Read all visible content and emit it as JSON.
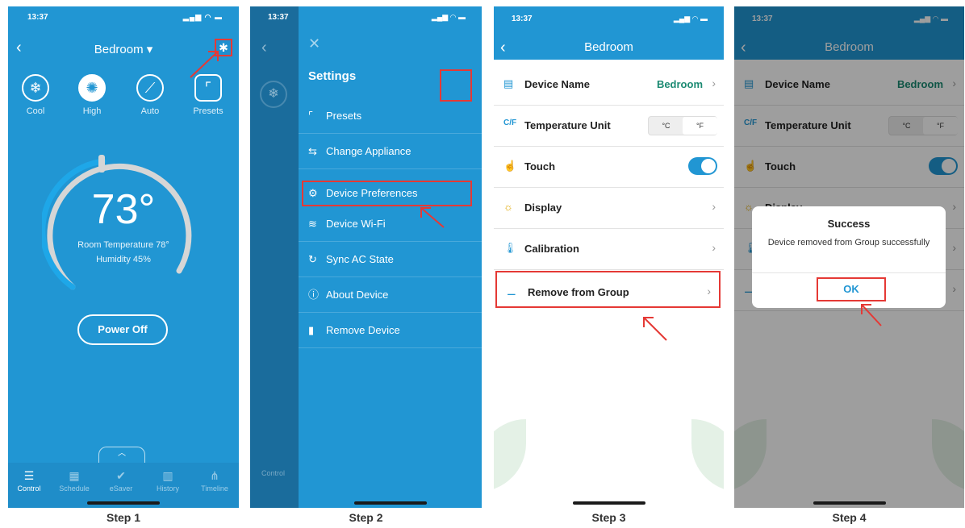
{
  "step1": {
    "time": "13:37",
    "title": "Bedroom ▾",
    "modes": [
      {
        "label": "Cool",
        "icon": "snowflake-icon"
      },
      {
        "label": "High",
        "icon": "fan-icon"
      },
      {
        "label": "Auto",
        "icon": "swing-icon"
      },
      {
        "label": "Presets",
        "icon": "presets-icon"
      }
    ],
    "temperature": "73°",
    "room_temperature": "Room Temperature 78°",
    "humidity": "Humidity 45%",
    "power_button": "Power Off",
    "tabs": [
      {
        "label": "Control",
        "icon": "sliders-icon"
      },
      {
        "label": "Schedule",
        "icon": "calendar-icon"
      },
      {
        "label": "eSaver",
        "icon": "leaf-icon"
      },
      {
        "label": "History",
        "icon": "bar-chart-icon"
      },
      {
        "label": "Timeline",
        "icon": "timeline-icon"
      }
    ],
    "caption": "Step 1"
  },
  "step2": {
    "time": "13:37",
    "heading": "Settings",
    "menu": [
      {
        "label": "Presets",
        "icon": "presets-icon"
      },
      {
        "label": "Change Appliance",
        "icon": "swap-icon"
      },
      {
        "label": "Device Preferences",
        "icon": "gears-icon"
      },
      {
        "label": "Device Wi-Fi",
        "icon": "wifi-icon"
      },
      {
        "label": "Sync AC State",
        "icon": "sync-icon"
      },
      {
        "label": "About Device",
        "icon": "info-icon"
      },
      {
        "label": "Remove Device",
        "icon": "trash-icon"
      }
    ],
    "side_tab": "Control",
    "caption": "Step 2"
  },
  "step3": {
    "time": "13:37",
    "title": "Bedroom",
    "rows": [
      {
        "label": "Device Name",
        "value": "Bedroom"
      },
      {
        "label": "Temperature Unit",
        "unit_c": "°C",
        "unit_f": "°F"
      },
      {
        "label": "Touch"
      },
      {
        "label": "Display"
      },
      {
        "label": "Calibration"
      },
      {
        "label": "Remove from Group"
      }
    ],
    "caption": "Step 3"
  },
  "step4": {
    "time": "13:37",
    "title": "Bedroom",
    "rows": [
      {
        "label": "Device Name",
        "value": "Bedroom"
      },
      {
        "label": "Temperature Unit",
        "unit_c": "°C",
        "unit_f": "°F"
      },
      {
        "label": "Touch"
      },
      {
        "label": "Display"
      }
    ],
    "dialog": {
      "title": "Success",
      "message": "Device removed from Group successfully",
      "ok": "OK"
    },
    "caption": "Step 4"
  },
  "colors": {
    "primary_blue": "#2196d3",
    "highlight_red": "#e53935",
    "value_green": "#1b8a72"
  }
}
